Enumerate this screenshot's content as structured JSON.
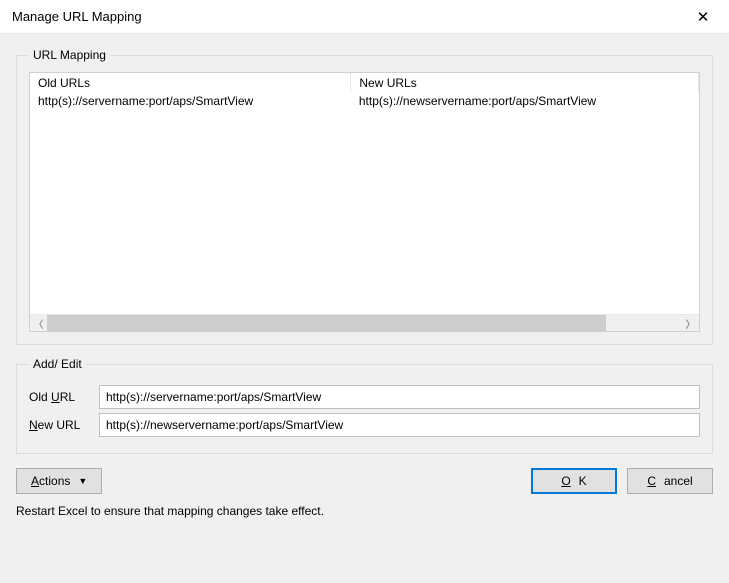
{
  "window": {
    "title": "Manage URL Mapping"
  },
  "group_mapping": {
    "legend": "URL Mapping",
    "columns": {
      "old": "Old URLs",
      "new": "New URLs"
    },
    "rows": [
      {
        "old": "http(s)://servername:port/aps/SmartView",
        "new": "http(s)://newservername:port/aps/SmartView"
      }
    ]
  },
  "group_edit": {
    "legend": "Add/ Edit",
    "old_label_pre": "Old ",
    "old_label_mn": "U",
    "old_label_post": "RL",
    "old_value": "http(s)://servername:port/aps/SmartView",
    "new_label_mn": "N",
    "new_label_post": "ew URL",
    "new_value": "http(s)://newservername:port/aps/SmartView"
  },
  "buttons": {
    "actions_mn": "A",
    "actions_post": "ctions",
    "ok_mn": "O",
    "ok_post": "K",
    "cancel_mn": "C",
    "cancel_post": "ancel"
  },
  "footnote": "Restart Excel to ensure that mapping changes take effect."
}
